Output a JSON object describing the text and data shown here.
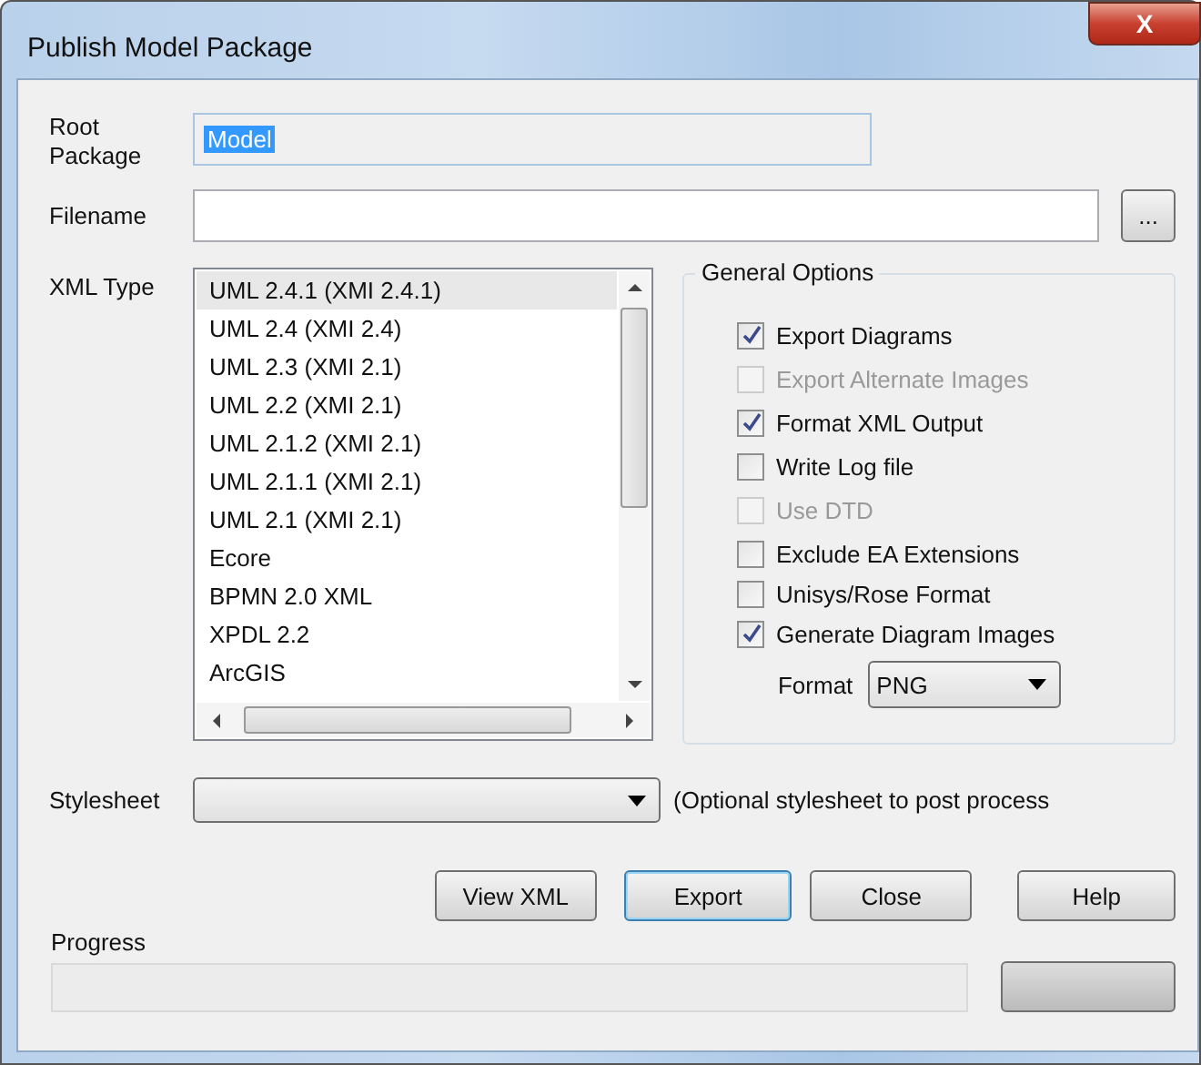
{
  "window": {
    "title": "Publish Model Package",
    "close": "X"
  },
  "root_package": {
    "label": "Root Package",
    "value": "Model"
  },
  "filename": {
    "label": "Filename",
    "browse": "..."
  },
  "xml_type": {
    "label": "XML Type",
    "items": [
      {
        "label": "UML 2.4.1 (XMI 2.4.1)",
        "selected": true
      },
      {
        "label": "UML 2.4 (XMI 2.4)",
        "selected": false
      },
      {
        "label": "UML 2.3 (XMI 2.1)",
        "selected": false
      },
      {
        "label": "UML 2.2 (XMI 2.1)",
        "selected": false
      },
      {
        "label": "UML 2.1.2 (XMI 2.1)",
        "selected": false
      },
      {
        "label": "UML 2.1.1 (XMI 2.1)",
        "selected": false
      },
      {
        "label": "UML 2.1 (XMI 2.1)",
        "selected": false
      },
      {
        "label": "Ecore",
        "selected": false
      },
      {
        "label": "BPMN 2.0 XML",
        "selected": false
      },
      {
        "label": "XPDL 2.2",
        "selected": false
      },
      {
        "label": "ArcGIS",
        "selected": false
      }
    ]
  },
  "general_options": {
    "title": "General Options",
    "options": [
      {
        "label": "Export Diagrams",
        "checked": true,
        "disabled": false
      },
      {
        "label": "Export Alternate Images",
        "checked": false,
        "disabled": true
      },
      {
        "label": "Format XML Output",
        "checked": true,
        "disabled": false
      },
      {
        "label": "Write Log file",
        "checked": false,
        "disabled": false
      },
      {
        "label": "Use DTD",
        "checked": false,
        "disabled": true
      },
      {
        "label": "Exclude EA Extensions",
        "checked": false,
        "disabled": false
      },
      {
        "label": "Unisys/Rose Format",
        "checked": false,
        "disabled": false
      },
      {
        "label": "Generate Diagram Images",
        "checked": true,
        "disabled": false
      }
    ],
    "format": {
      "label": "Format",
      "value": "PNG"
    }
  },
  "stylesheet": {
    "label": "Stylesheet",
    "note": "(Optional stylesheet to post process"
  },
  "buttons": [
    {
      "label": "View XML",
      "default": false
    },
    {
      "label": "Export",
      "default": true
    },
    {
      "label": "Close",
      "default": false
    },
    {
      "label": "Help",
      "default": false
    }
  ],
  "progress": {
    "label": "Progress",
    "level": 0
  }
}
